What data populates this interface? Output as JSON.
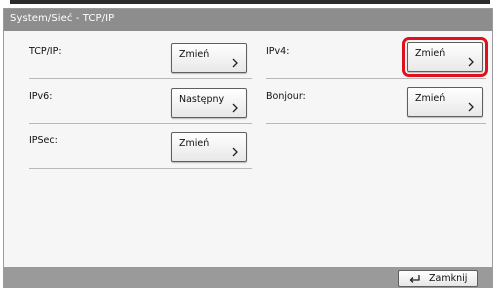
{
  "window": {
    "title": "System/Sieć - TCP/IP"
  },
  "settings": [
    {
      "label": "TCP/IP:",
      "button": "Zmień"
    },
    {
      "label": "IPv4:",
      "button": "Zmień",
      "highlighted": true
    },
    {
      "label": "IPv6:",
      "button": "Następny"
    },
    {
      "label": "Bonjour:",
      "button": "Zmień"
    },
    {
      "label": "IPSec:",
      "button": "Zmień"
    }
  ],
  "footer": {
    "close_label": "Zamknij",
    "close_icon": "enter-return-icon"
  },
  "colors": {
    "highlight": "#e0101c",
    "titlebar": "#8d8d8d",
    "bottombar": "#9a9a9a"
  }
}
